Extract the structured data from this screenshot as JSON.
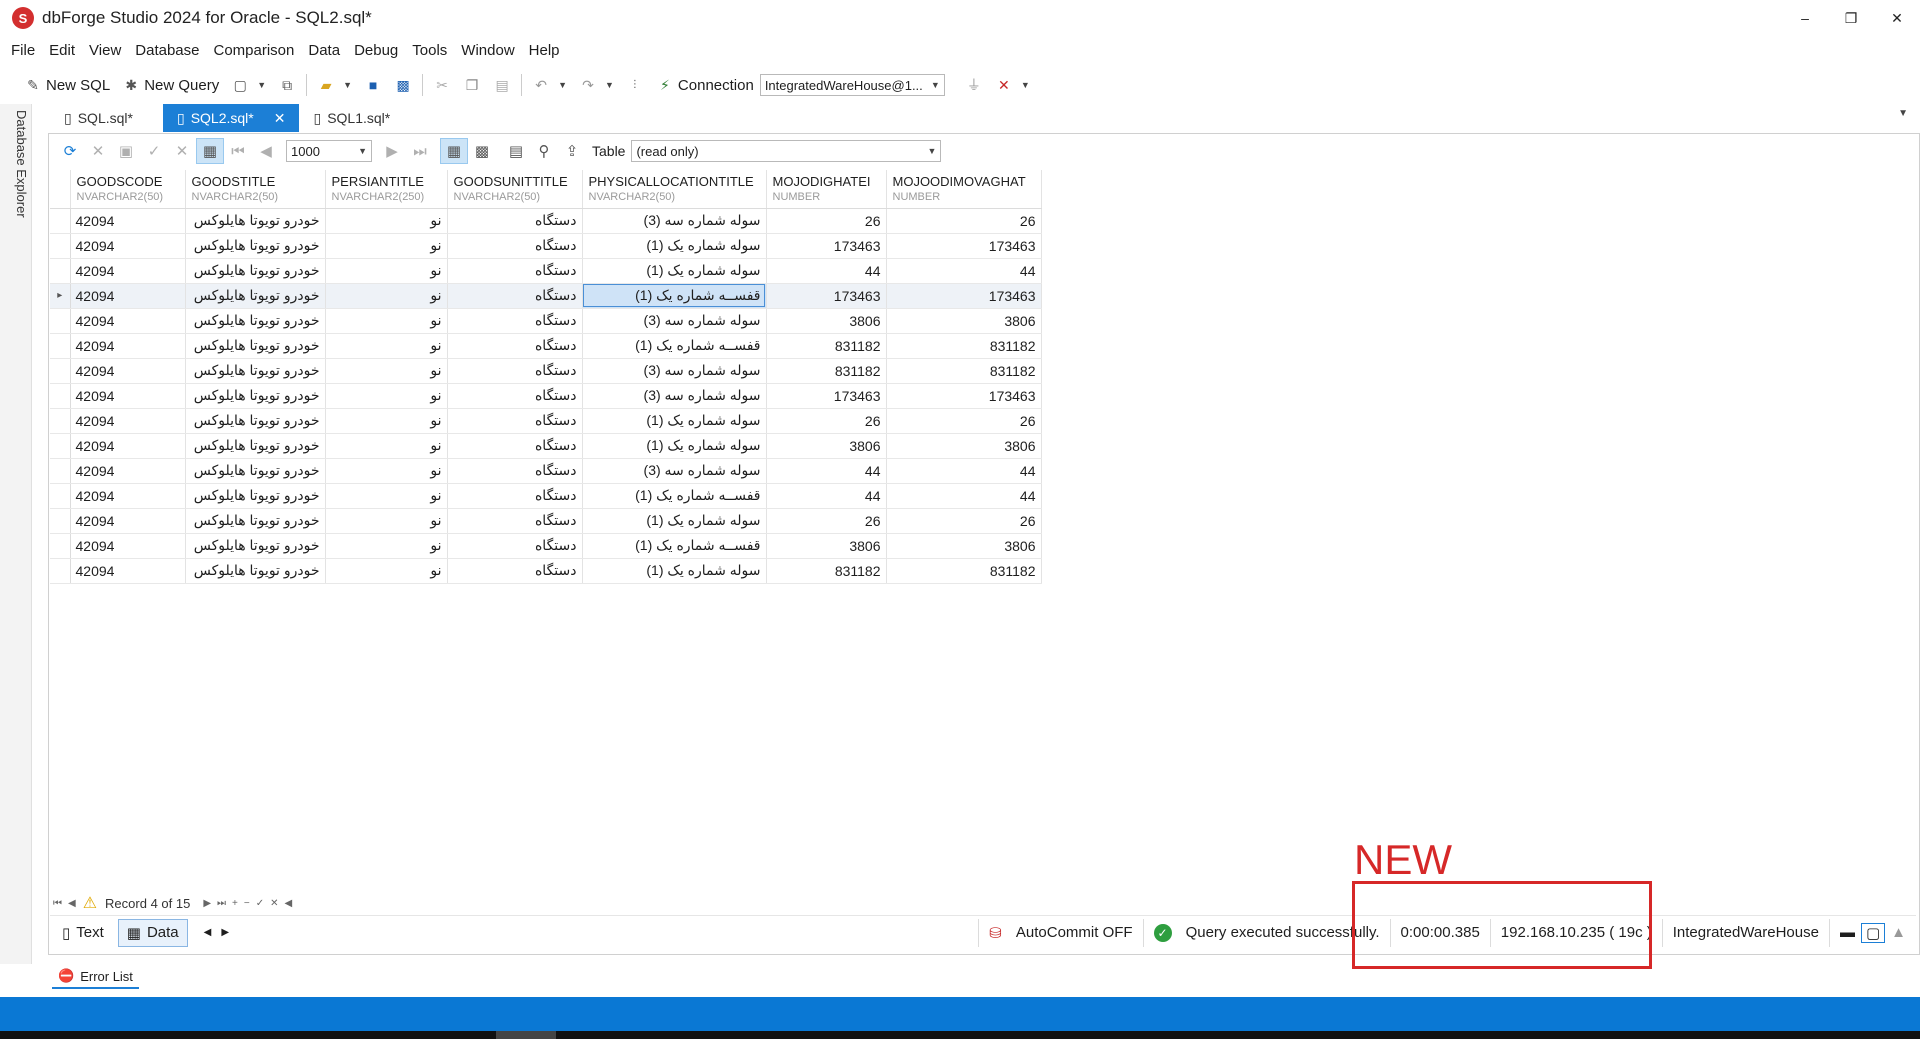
{
  "window": {
    "logo_glyph": "S",
    "title": "dbForge Studio 2024 for Oracle - SQL2.sql*",
    "minimize": "–",
    "maximize": "❐",
    "close": "✕"
  },
  "menu": [
    "File",
    "Edit",
    "View",
    "Database",
    "Comparison",
    "Data",
    "Debug",
    "Tools",
    "Window",
    "Help"
  ],
  "toolbar": {
    "new_sql": "New SQL",
    "new_query": "New Query",
    "connection_label": "Connection",
    "connection_value": "IntegratedWareHouse@1..."
  },
  "sidebar": {
    "database_explorer": "Database Explorer"
  },
  "tabs": [
    {
      "label": "SQL.sql*"
    },
    {
      "label": "SQL2.sql*"
    },
    {
      "label": "SQL1.sql*"
    }
  ],
  "grid_toolbar": {
    "page_size": "1000",
    "table_label": "Table",
    "table_mode": "(read only)"
  },
  "columns": [
    {
      "name": "GOODSCODE",
      "type": "NVARCHAR2(50)"
    },
    {
      "name": "GOODSTITLE",
      "type": "NVARCHAR2(50)"
    },
    {
      "name": "PERSIANTITLE",
      "type": "NVARCHAR2(250)"
    },
    {
      "name": "GOODSUNITTITLE",
      "type": "NVARCHAR2(50)"
    },
    {
      "name": "PHYSICALLOCATIONTITLE",
      "type": "NVARCHAR2(50)"
    },
    {
      "name": "MOJODIGHATEI",
      "type": "NUMBER"
    },
    {
      "name": "MOJOODIMOVAGHAT",
      "type": "NUMBER"
    }
  ],
  "rows": [
    [
      "42094",
      "خودرو تویوتا هایلوکس",
      "نو",
      "دستگاه",
      "سوله شماره سه (3)",
      "26",
      "26"
    ],
    [
      "42094",
      "خودرو تویوتا هایلوکس",
      "نو",
      "دستگاه",
      "سوله شماره یک (1)",
      "173463",
      "173463"
    ],
    [
      "42094",
      "خودرو تویوتا هایلوکس",
      "نو",
      "دستگاه",
      "سوله شماره یک (1)",
      "44",
      "44"
    ],
    [
      "42094",
      "خودرو تویوتا هایلوکس",
      "نو",
      "دستگاه",
      "قفســه شماره یک (1)",
      "173463",
      "173463"
    ],
    [
      "42094",
      "خودرو تویوتا هایلوکس",
      "نو",
      "دستگاه",
      "سوله شماره سه (3)",
      "3806",
      "3806"
    ],
    [
      "42094",
      "خودرو تویوتا هایلوکس",
      "نو",
      "دستگاه",
      "قفســه شماره یک (1)",
      "831182",
      "831182"
    ],
    [
      "42094",
      "خودرو تویوتا هایلوکس",
      "نو",
      "دستگاه",
      "سوله شماره سه (3)",
      "831182",
      "831182"
    ],
    [
      "42094",
      "خودرو تویوتا هایلوکس",
      "نو",
      "دستگاه",
      "سوله شماره سه (3)",
      "173463",
      "173463"
    ],
    [
      "42094",
      "خودرو تویوتا هایلوکس",
      "نو",
      "دستگاه",
      "سوله شماره یک (1)",
      "26",
      "26"
    ],
    [
      "42094",
      "خودرو تویوتا هایلوکس",
      "نو",
      "دستگاه",
      "سوله شماره یک (1)",
      "3806",
      "3806"
    ],
    [
      "42094",
      "خودرو تویوتا هایلوکس",
      "نو",
      "دستگاه",
      "سوله شماره سه (3)",
      "44",
      "44"
    ],
    [
      "42094",
      "خودرو تویوتا هایلوکس",
      "نو",
      "دستگاه",
      "قفســه شماره یک (1)",
      "44",
      "44"
    ],
    [
      "42094",
      "خودرو تویوتا هایلوکس",
      "نو",
      "دستگاه",
      "سوله شماره یک (1)",
      "26",
      "26"
    ],
    [
      "42094",
      "خودرو تویوتا هایلوکس",
      "نو",
      "دستگاه",
      "قفســه شماره یک (1)",
      "3806",
      "3806"
    ],
    [
      "42094",
      "خودرو تویوتا هایلوکس",
      "نو",
      "دستگاه",
      "سوله شماره یک (1)",
      "831182",
      "831182"
    ]
  ],
  "current_row": 4,
  "record_nav": {
    "status": "Record 4 of 15"
  },
  "bottom": {
    "text_tab": "Text",
    "data_tab": "Data",
    "autocommit": "AutoCommit OFF",
    "query_status": "Query executed successfully.",
    "elapsed": "0:00:00.385",
    "server": "192.168.10.235 ( 19c )",
    "database": "IntegratedWareHouse",
    "error_list": "Error List"
  },
  "annotation": {
    "label": "NEW",
    "color": "#d62828"
  },
  "colors": {
    "accent": "#1c7fd6",
    "taskbar": "#0a78d4",
    "success": "#2e9e3f"
  }
}
